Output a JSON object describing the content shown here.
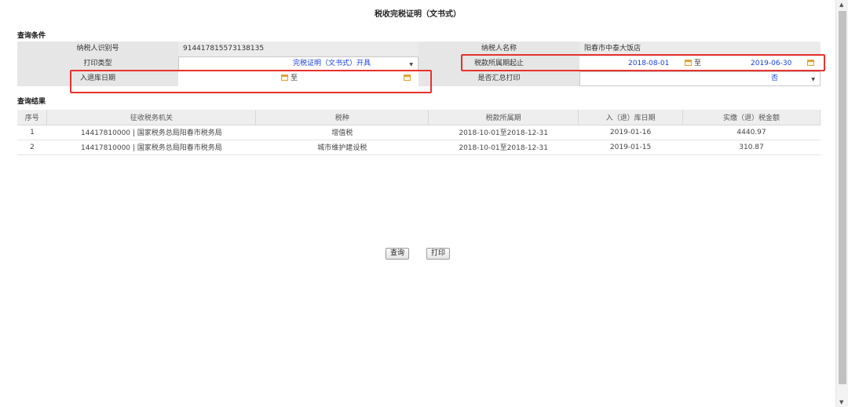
{
  "page": {
    "title": "税收完税证明（文书式）"
  },
  "conditions": {
    "section_title": "查询条件",
    "taxpayer_id_label": "纳税人识别号",
    "taxpayer_id_value": "914417815573138135",
    "taxpayer_name_label": "纳税人名称",
    "taxpayer_name_value": "阳春市中泰大饭店",
    "print_type_label": "打印类型",
    "print_type_value": "完税证明（文书式）开具",
    "tax_period_label": "税款所属期起止",
    "tax_period_start": "2018-08-01",
    "tax_period_sep": "至",
    "tax_period_end": "2019-06-30",
    "storage_date_label": "入退库日期",
    "storage_date_sep": "至",
    "summary_print_label": "是否汇总打印",
    "summary_print_value": "否"
  },
  "results": {
    "section_title": "查询结果",
    "columns": [
      "序号",
      "征收税务机关",
      "税种",
      "税款所属期",
      "入（退）库日期",
      "实缴（退）税金额"
    ],
    "rows": [
      [
        "1",
        "14417810000 | 国家税务总局阳春市税务局",
        "增值税",
        "2018-10-01至2018-12-31",
        "2019-01-16",
        "4440.97"
      ],
      [
        "2",
        "14417810000 | 国家税务总局阳春市税务局",
        "城市维护建设税",
        "2018-10-01至2018-12-31",
        "2019-01-15",
        "310.87"
      ]
    ]
  },
  "buttons": {
    "query": "查询",
    "print": "打印"
  },
  "icons": {
    "calendar": "calendar-icon",
    "dropdown": "chevron-down-icon",
    "scroll_up": "arrow-up-icon",
    "scroll_down": "arrow-down-icon"
  },
  "colors": {
    "highlight": "#e8322e",
    "value_blue": "#1a3fd6",
    "calendar": "#e0a23a"
  }
}
